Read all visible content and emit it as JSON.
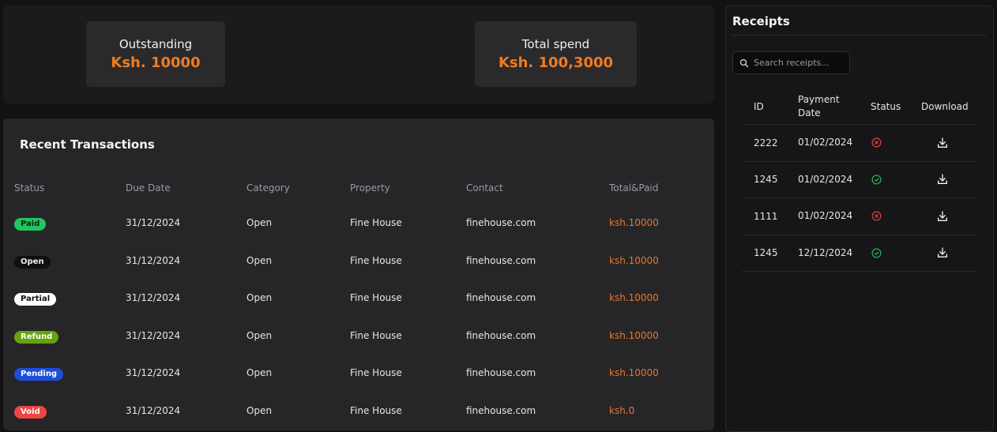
{
  "summary": {
    "outstanding_label": "Outstanding",
    "outstanding_value": "Ksh. 10000",
    "total_spend_label": "Total spend",
    "total_spend_value": "Ksh. 100,3000"
  },
  "transactions": {
    "title": "Recent Transactions",
    "columns": [
      "Status",
      "Due Date",
      "Category",
      "Property",
      "Contact",
      "Total&Paid"
    ],
    "rows": [
      {
        "status": "Paid",
        "due": "31/12/2024",
        "category": "Open",
        "property": "Fine House",
        "contact": "finehouse.com",
        "total": "ksh.10000"
      },
      {
        "status": "Open",
        "due": "31/12/2024",
        "category": "Open",
        "property": "Fine House",
        "contact": "finehouse.com",
        "total": "ksh.10000"
      },
      {
        "status": "Partial",
        "due": "31/12/2024",
        "category": "Open",
        "property": "Fine House",
        "contact": "finehouse.com",
        "total": "ksh.10000"
      },
      {
        "status": "Refund",
        "due": "31/12/2024",
        "category": "Open",
        "property": "Fine House",
        "contact": "finehouse.com",
        "total": "ksh.10000"
      },
      {
        "status": "Pending",
        "due": "31/12/2024",
        "category": "Open",
        "property": "Fine House",
        "contact": "finehouse.com",
        "total": "ksh.10000"
      },
      {
        "status": "Void",
        "due": "31/12/2024",
        "category": "Open",
        "property": "Fine House",
        "contact": "finehouse.com",
        "total": "ksh.0"
      }
    ]
  },
  "receipts": {
    "title": "Receipts",
    "search_placeholder": "Search receipts...",
    "columns": {
      "id": "ID",
      "date_line1": "Payment",
      "date_line2": "Date",
      "status": "Status",
      "download": "Download"
    },
    "rows": [
      {
        "id": "2222",
        "date": "01/02/2024",
        "status_icon": "x-circle-icon"
      },
      {
        "id": "1245",
        "date": "01/02/2024",
        "status_icon": "check-circle-icon"
      },
      {
        "id": "1111",
        "date": "01/02/2024",
        "status_icon": "x-circle-icon"
      },
      {
        "id": "1245",
        "date": "12/12/2024",
        "status_icon": "check-circle-icon"
      }
    ]
  },
  "colors": {
    "accent": "#f07b20",
    "panel": "#262628",
    "paid": "#22c55e",
    "refund": "#65a30d",
    "pending": "#1d4ed8",
    "void": "#ef4444",
    "status_fail": "#ef4444",
    "status_ok": "#22c55e"
  }
}
